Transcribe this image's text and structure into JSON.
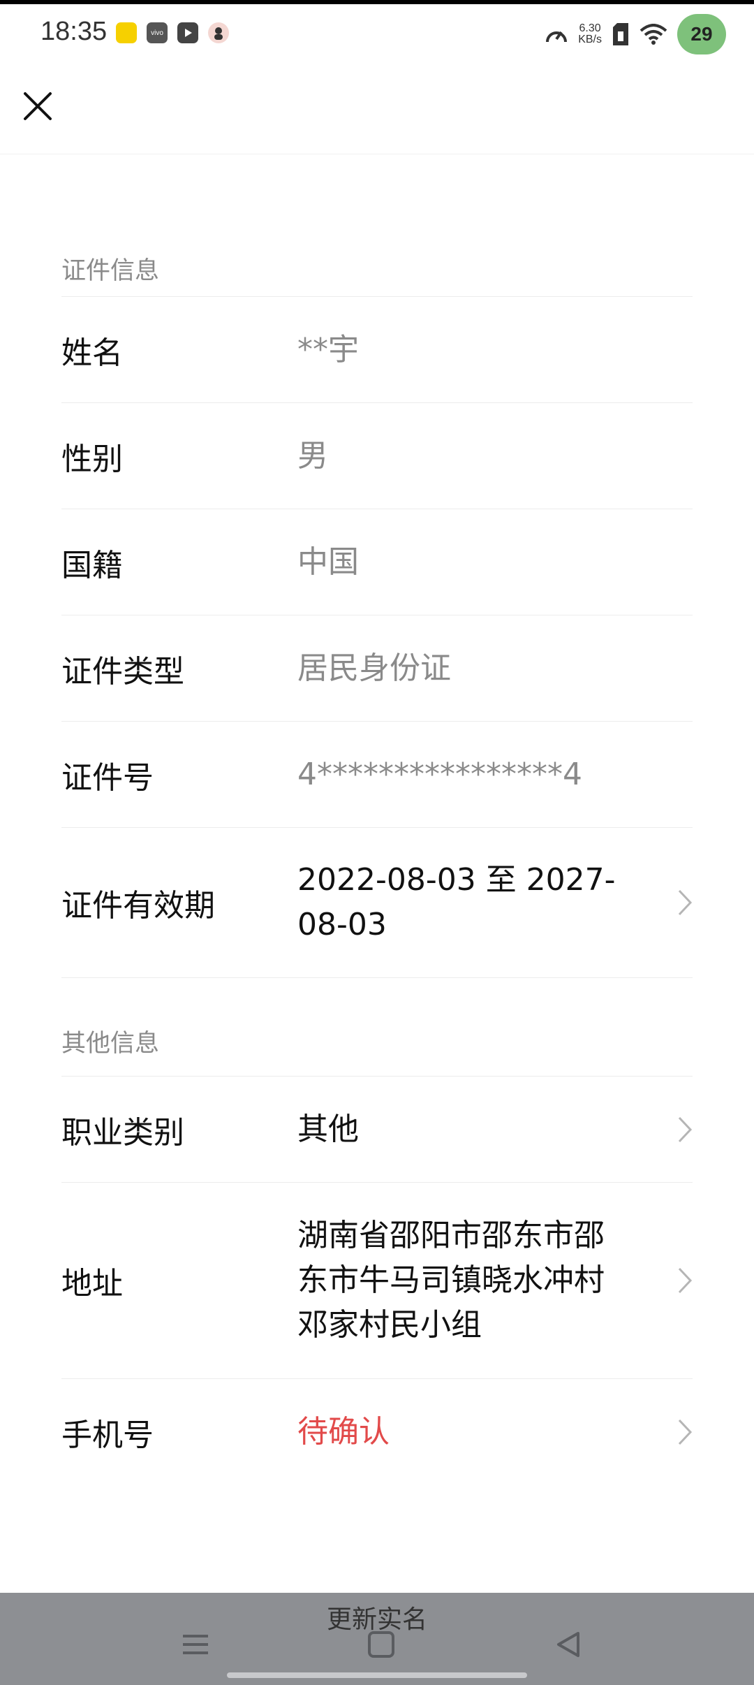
{
  "status_bar": {
    "time": "18:35",
    "app_icons": [
      "app-icon-yellow",
      "vivo-icon",
      "video-play-icon",
      "avatar-icon"
    ],
    "app_labels": {
      "vivo": "vivo"
    },
    "net_speed_value": "6.30",
    "net_speed_unit": "KB/s",
    "battery": "29"
  },
  "sections": [
    {
      "title": "证件信息",
      "rows": [
        {
          "label": "姓名",
          "value": "**宇"
        },
        {
          "label": "性别",
          "value": "男"
        },
        {
          "label": "国籍",
          "value": "中国"
        },
        {
          "label": "证件类型",
          "value": "居民身份证"
        },
        {
          "label": "证件号",
          "value": "4****************4"
        },
        {
          "label": "证件有效期",
          "value": "2022-08-03 至 2027-08-03"
        }
      ]
    },
    {
      "title": "其他信息",
      "rows": [
        {
          "label": "职业类别",
          "value": "其他"
        },
        {
          "label": "地址",
          "value": "湖南省邵阳市邵东市邵东市牛马司镇晓水冲村邓家村民小组"
        },
        {
          "label": "手机号",
          "value": "待确认"
        }
      ]
    }
  ],
  "bottom": {
    "update_label": "更新实名"
  },
  "colors": {
    "accent_red": "#e24a4a",
    "muted_text": "#8a8a8a",
    "bottom_bar": "#8d8f93"
  }
}
